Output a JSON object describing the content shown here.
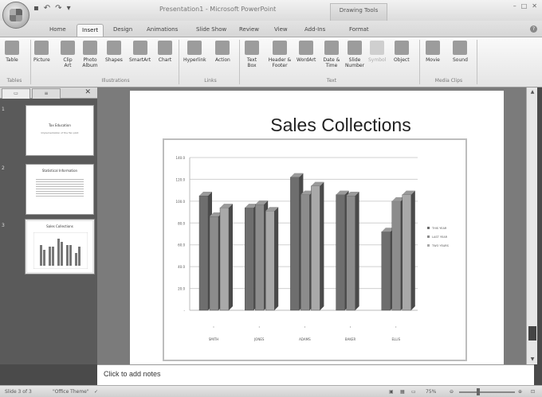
{
  "window": {
    "title": "Presentation1 - Microsoft PowerPoint",
    "context_tab_header": "Drawing Tools"
  },
  "tabs": [
    "Home",
    "Insert",
    "Design",
    "Animations",
    "Slide Show",
    "Review",
    "View",
    "Add-Ins",
    "Format"
  ],
  "active_tab": "Insert",
  "ribbon": {
    "groups": {
      "tables": "Tables",
      "illustrations": "Illustrations",
      "links": "Links",
      "text": "Text",
      "media": "Media Clips"
    },
    "buttons": {
      "table": "Table",
      "picture": "Picture",
      "clip_art": "Clip Art",
      "photo_album": "Photo Album",
      "shapes": "Shapes",
      "smartart": "SmartArt",
      "chart": "Chart",
      "hyperlink": "Hyperlink",
      "action": "Action",
      "text_box": "Text Box",
      "header_footer": "Header & Footer",
      "wordart": "WordArt",
      "date_time": "Date & Time",
      "slide_number": "Slide Number",
      "symbol": "Symbol",
      "object": "Object",
      "movie": "Movie",
      "sound": "Sound"
    }
  },
  "slides": [
    {
      "num": "1",
      "title": "Tax Education",
      "subtitle": "Implementation of the Tax pilot"
    },
    {
      "num": "2",
      "title": "Statistical Information",
      "subtitle": ""
    },
    {
      "num": "3",
      "title": "Sales Collections",
      "subtitle": ""
    }
  ],
  "main_slide": {
    "title": "Sales Collections"
  },
  "chart_data": {
    "type": "bar",
    "categories": [
      "SMITH",
      "JONES",
      "ADAMS",
      "BAKER",
      "ELLIS"
    ],
    "series": [
      {
        "name": "THIS YEAR",
        "values": [
          105,
          94,
          122,
          106,
          72
        ],
        "color": "#6e6e6e"
      },
      {
        "name": "LAST YEAR",
        "values": [
          86,
          97,
          106,
          105,
          100
        ],
        "color": "#8c8c8c"
      },
      {
        "name": "TWO YEARS",
        "values": [
          94,
          91,
          114,
          0,
          106
        ],
        "color": "#a9a9a9"
      }
    ],
    "yticks": [
      "140.0",
      "120.0",
      "100.0",
      "80.0",
      "60.0",
      "40.0",
      "20.0",
      "-"
    ],
    "ylim": [
      0,
      140
    ],
    "grid": true,
    "legend_position": "right",
    "style": "3d-column"
  },
  "notes_placeholder": "Click to add notes",
  "status": {
    "slide_info": "Slide 3 of 3",
    "theme": "\"Office Theme\"",
    "zoom": "75%"
  },
  "colors": {
    "ribbon": "#eeeeee",
    "workspace": "#7b7b7b"
  }
}
